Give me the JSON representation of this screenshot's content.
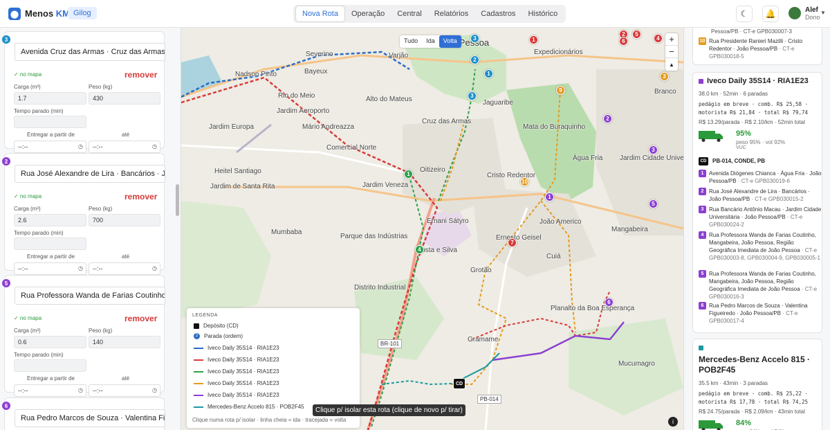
{
  "header": {
    "logo_main": "Menos ",
    "logo_accent": "KM",
    "org": "Gilog",
    "nav": [
      {
        "label": "Nova Rota",
        "active": true
      },
      {
        "label": "Operação",
        "active": false
      },
      {
        "label": "Central",
        "active": false
      },
      {
        "label": "Relatórios",
        "active": false
      },
      {
        "label": "Cadastros",
        "active": false
      },
      {
        "label": "Histórico",
        "active": false
      }
    ],
    "user_name": "Alef",
    "user_role": "Dono"
  },
  "left": {
    "labels": {
      "on_map": "✓ no mapa",
      "remove": "remover",
      "cargo": "Carga (m³)",
      "weight": "Peso (kg)",
      "stop_time": "Tempo parado (min)",
      "deliver_from": "Entregar a partir de",
      "until": "até",
      "time_placeholder": "--:--"
    },
    "stops": [
      {
        "num": "3",
        "color": "#1b8fc9",
        "address": "Avenida Cruz das Armas · Cruz das Armas",
        "cargo": "1.7",
        "weight": "430"
      },
      {
        "num": "2",
        "color": "#8c3fd1",
        "address": "Rua José Alexandre de Lira · Bancários · Jo",
        "cargo": "2.6",
        "weight": "700"
      },
      {
        "num": "5",
        "color": "#8c3fd1",
        "address": "Rua Professora Wanda de Farias Coutinho",
        "cargo": "0.6",
        "weight": "140"
      },
      {
        "num": "6",
        "color": "#8c3fd1",
        "address": "Rua Pedro Marcos de Souza · Valentina Fig"
      }
    ]
  },
  "map": {
    "direction_toggle": [
      {
        "label": "Tudo",
        "active": false
      },
      {
        "label": "Ida",
        "active": false
      },
      {
        "label": "Volta",
        "active": true
      }
    ],
    "zoom_in": "+",
    "zoom_out": "−",
    "compass": "▲",
    "places": [
      {
        "text": "João Pessoa",
        "big": true
      },
      {
        "text": "Nadson Pinto"
      },
      {
        "text": "Bayeux"
      },
      {
        "text": "Rio do Meio"
      },
      {
        "text": "Jardim Aeroporto"
      },
      {
        "text": "Jardim Europa"
      },
      {
        "text": "Mário Andreazza"
      },
      {
        "text": "Comercial Norte"
      },
      {
        "text": "Heitel Santiago"
      },
      {
        "text": "Jardim de Santa Rita"
      },
      {
        "text": "Mumbaba"
      },
      {
        "text": "Parque das Indústrias"
      },
      {
        "text": "Distrito Industrial"
      },
      {
        "text": "Jardim Veneza"
      },
      {
        "text": "Oitizeiro"
      },
      {
        "text": "Cruz das Armas"
      },
      {
        "text": "Alto do Mateus"
      },
      {
        "text": "Jaguaribe"
      },
      {
        "text": "Cristo Redentor"
      },
      {
        "text": "Ernani Sátyro"
      },
      {
        "text": "Costa e Silva"
      },
      {
        "text": "Grotão"
      },
      {
        "text": "Ernesto Geisel"
      },
      {
        "text": "Cuiá"
      },
      {
        "text": "João Americo"
      },
      {
        "text": "Água Fria"
      },
      {
        "text": "Mangabeira"
      },
      {
        "text": "Jardim Cidade Universitária"
      },
      {
        "text": "Mata do Buraquinho"
      },
      {
        "text": "Planalto da Boa Esperança"
      },
      {
        "text": "Gramame"
      },
      {
        "text": "Mucumagro"
      },
      {
        "text": "Expedicionários"
      },
      {
        "text": "Branco"
      },
      {
        "text": "Severino"
      },
      {
        "text": "Varjão"
      }
    ],
    "road_shields": [
      "BR-101",
      "PB-014"
    ],
    "depot_label": "CD",
    "legend": {
      "title": "LEGENDA",
      "depot": "Depósito (CD)",
      "stop": "Parada (ordem)",
      "stop_icon": "2",
      "routes": [
        {
          "name": "Iveco Daily 35S14 · RIA1E23",
          "color": "#2b6cc4"
        },
        {
          "name": "Iveco Daily 35S14 · RIA1E23",
          "color": "#d93a3a"
        },
        {
          "name": "Iveco Daily 35S14 · RIA1E23",
          "color": "#2ea04a"
        },
        {
          "name": "Iveco Daily 35S14 · RIA1E23",
          "color": "#e59a1f"
        },
        {
          "name": "Iveco Daily 35S14 · RIA1E23",
          "color": "#8c3fd1"
        },
        {
          "name": "Mercedes-Benz Accelo 815 · POB2F45",
          "color": "#1a9aa0"
        }
      ],
      "footer": "Clique numa rota p/ isolar · linha cheia = ida · tracejada = volta"
    },
    "tooltip": "Clique p/ isolar esta rota (clique de novo p/ tirar)",
    "info": "i"
  },
  "right": {
    "top_card": {
      "line1": "Pessoa/PB · CT-e GPB030007-3",
      "stop": {
        "num": "10",
        "color": "#e59a1f",
        "text": "Rua Presidente Ranieri Mazilli · Cristo Redentor · João Pessoa/PB",
        "ct": " · CT-e GPB030018-5"
      }
    },
    "vehicle1": {
      "color": "#8c3fd1",
      "title": "Iveco Daily 35S14 · RIA1E23",
      "summary": "38.0 km · 52min · 6 paradas",
      "costs1": "pedágio em breve · comb. R$ 25,58 ·",
      "costs2": "motorista R$ 21,84 · total R$ 79,74",
      "per": "R$ 13.29/parada · R$ 2.10/km · 52min total",
      "pct": "95%",
      "pct_detail": "peso 95% · vol 92%",
      "limit": "VUC",
      "depot_badge": "CD",
      "depot_name": "PB-014, CONDE, PB",
      "stops": [
        {
          "num": "1",
          "text": "Avenida Diógenes Chianca · Água Fria · João Pessoa/PB",
          "ct": " · CT-e GPB030019-6"
        },
        {
          "num": "2",
          "text": "Rua José Alexandre de Lira · Bancários · João Pessoa/PB",
          "ct": " · CT-e GPB030015-2"
        },
        {
          "num": "3",
          "text": "Rua Bancário Antônio Macau · Jardim Cidade Universitária · João Pessoa/PB",
          "ct": " · CT-e GPB030024-2"
        },
        {
          "num": "4",
          "text": "Rua Professora Wanda de Farias Coutinho, Mangabeira, João Pessoa, Região Geográfica Imediata de João Pessoa",
          "ct": " · CT-e GPB030003-8, GPB030004-9, GPB030005-1"
        },
        {
          "num": "5",
          "text": "Rua Professora Wanda de Farias Coutinho, Mangabeira, João Pessoa, Região Geográfica Imediata de João Pessoa",
          "ct": " · CT-e GPB030016-3"
        },
        {
          "num": "6",
          "text": "Rua Pedro Marcos de Souza · Valentina Figueiredo · João Pessoa/PB",
          "ct": " · CT-e GPB030017-4"
        }
      ]
    },
    "vehicle2": {
      "color": "#1a9aa0",
      "title": "Mercedes-Benz Accelo 815 · POB2F45",
      "summary": "35.5 km · 43min · 3 paradas",
      "costs1": "pedágio em breve · comb. R$ 25,22 ·",
      "costs2": "motorista R$ 17,78 · total R$ 74,25",
      "per": "R$ 24.75/parada · R$ 2.09/km · 43min total",
      "pct": "84%",
      "pct_detail": "peso 84% · vol 74%"
    }
  }
}
